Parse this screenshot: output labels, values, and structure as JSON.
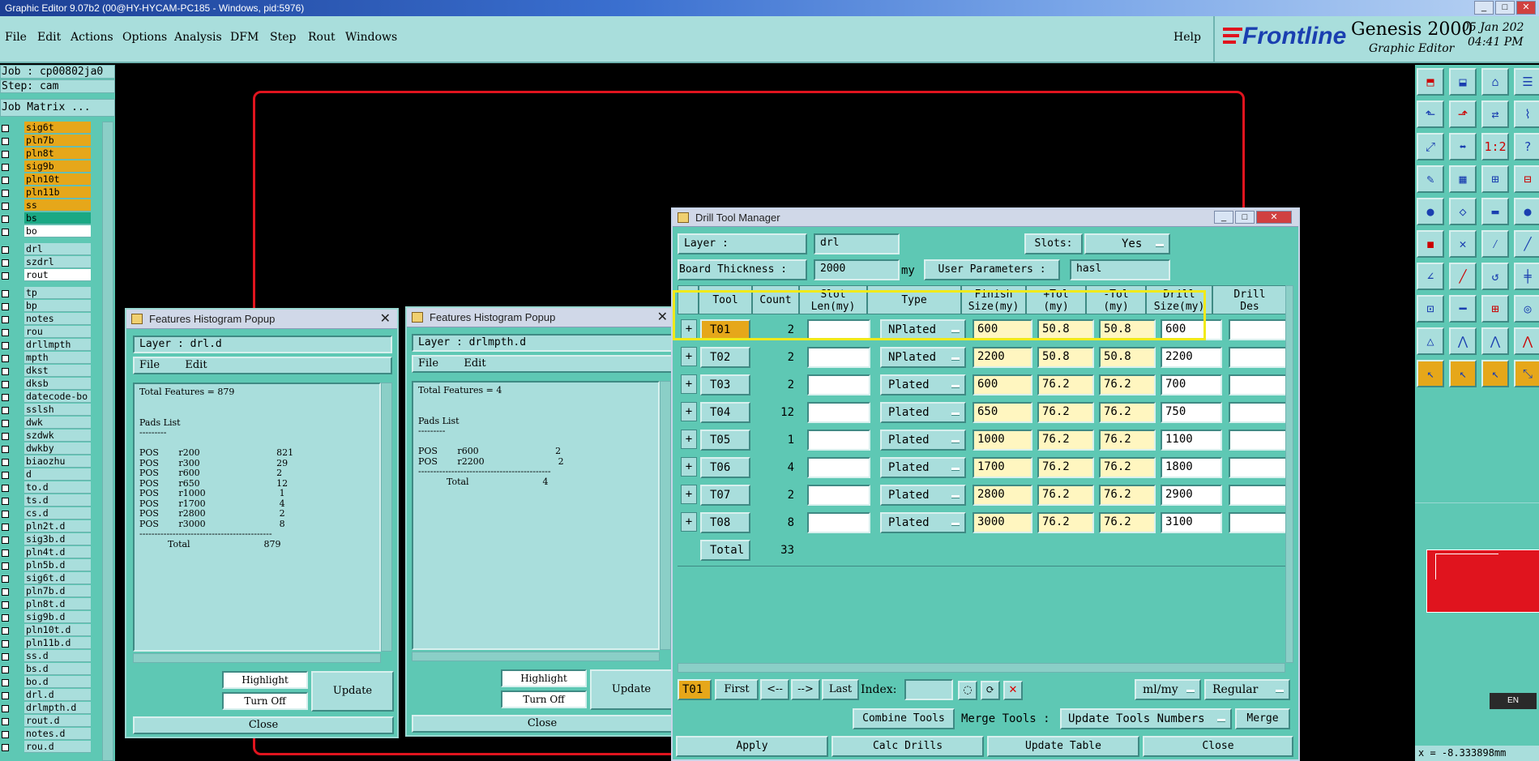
{
  "window": {
    "title": "Graphic Editor 9.07b2 (00@HY-HYCAM-PC185 - Windows, pid:5976)"
  },
  "menu": {
    "items": [
      "File",
      "Edit",
      "Actions",
      "Options",
      "Analysis",
      "DFM",
      "Step",
      "Rout",
      "Windows"
    ],
    "help": "Help"
  },
  "brand": {
    "logo": "Frontline",
    "product": "Genesis 2000",
    "subtitle": "Graphic Editor",
    "date": "05 Jan 202",
    "time": "04:41 PM"
  },
  "left_panel": {
    "job": "Job : cp00802ja0",
    "step": "Step: cam",
    "job_matrix": "Job Matrix ...",
    "layers_top": [
      {
        "name": "sig6t",
        "color": "#e6a71a"
      },
      {
        "name": "pln7b",
        "color": "#e6a71a"
      },
      {
        "name": "pln8t",
        "color": "#e6a71a"
      },
      {
        "name": "sig9b",
        "color": "#e6a71a"
      },
      {
        "name": "pln10t",
        "color": "#e6a71a"
      },
      {
        "name": "pln11b",
        "color": "#e6a71a"
      },
      {
        "name": "ss",
        "color": "#e6a71a"
      },
      {
        "name": "bs",
        "color": "#1aa884"
      },
      {
        "name": "bo",
        "color": "#ffffff"
      }
    ],
    "layers_drill": [
      {
        "name": "drl",
        "color": "#a9dedc"
      },
      {
        "name": "szdrl",
        "color": "#a9dedc"
      },
      {
        "name": "rout",
        "color": "#ffffff"
      }
    ],
    "layers_misc": [
      "tp",
      "bp",
      "notes",
      "rou",
      "drllmpth",
      "mpth",
      "dkst",
      "dksb",
      "datecode-bo",
      "sslsh",
      "dwk",
      "szdwk",
      "dwkby",
      "biaozhu",
      "d",
      "to.d",
      "ts.d",
      "cs.d",
      "pln2t.d",
      "sig3b.d",
      "pln4t.d",
      "pln5b.d",
      "sig6t.d",
      "pln7b.d",
      "pln8t.d",
      "sig9b.d",
      "pln10t.d",
      "pln11b.d",
      "ss.d",
      "bs.d",
      "bo.d",
      "drl.d",
      "drlmpth.d",
      "rout.d",
      "notes.d",
      "rou.d"
    ]
  },
  "histogram1": {
    "title": "Features Histogram Popup",
    "layer": "Layer :  drl.d",
    "menu": [
      "File",
      "Edit"
    ],
    "content": "Total Features = 879\n\n\nPads List\n---------\n\nPOS       r200                           821\nPOS       r300                           29\nPOS       r600                           2\nPOS       r650                           12\nPOS       r1000                          1\nPOS       r1700                          4\nPOS       r2800                          2\nPOS       r3000                          8\n--------------------------------------------\n          Total                          879",
    "highlight": "Highlight",
    "turn_off": "Turn Off",
    "update": "Update",
    "close": "Close"
  },
  "histogram2": {
    "title": "Features Histogram Popup",
    "layer": "Layer :  drlmpth.d",
    "menu": [
      "File",
      "Edit"
    ],
    "content": "Total Features = 4\n\n\nPads List\n---------\n\nPOS       r600                           2\nPOS       r2200                          2\n--------------------------------------------\n          Total                          4",
    "highlight": "Highlight",
    "turn_off": "Turn Off",
    "update": "Update",
    "close": "Close"
  },
  "dtm": {
    "title": "Drill Tool Manager",
    "layer_label": "Layer        :",
    "layer_value": "drl",
    "slots_label": "Slots:",
    "slots_value": "Yes",
    "board_thickness_label": "Board Thickness :",
    "board_thickness_value": "2000",
    "board_thickness_unit": "my",
    "user_params_label": "User Parameters :",
    "user_params_value": "hasl",
    "headers": [
      "Tool",
      "Count",
      "Slot\nLen(my)",
      "Type",
      "Finish\nSize(my)",
      "+Tol\n(my)",
      "-Tol\n(my)",
      "Drill\nSize(my)",
      "Drill\nDes"
    ],
    "rows": [
      {
        "tool": "T01",
        "count": "2",
        "type": "NPlated",
        "finish": "600",
        "ptol": "50.8",
        "ntol": "50.8",
        "drill": "600"
      },
      {
        "tool": "T02",
        "count": "2",
        "type": "NPlated",
        "finish": "2200",
        "ptol": "50.8",
        "ntol": "50.8",
        "drill": "2200"
      },
      {
        "tool": "T03",
        "count": "2",
        "type": "Plated",
        "finish": "600",
        "ptol": "76.2",
        "ntol": "76.2",
        "drill": "700"
      },
      {
        "tool": "T04",
        "count": "12",
        "type": "Plated",
        "finish": "650",
        "ptol": "76.2",
        "ntol": "76.2",
        "drill": "750"
      },
      {
        "tool": "T05",
        "count": "1",
        "type": "Plated",
        "finish": "1000",
        "ptol": "76.2",
        "ntol": "76.2",
        "drill": "1100"
      },
      {
        "tool": "T06",
        "count": "4",
        "type": "Plated",
        "finish": "1700",
        "ptol": "76.2",
        "ntol": "76.2",
        "drill": "1800"
      },
      {
        "tool": "T07",
        "count": "2",
        "type": "Plated",
        "finish": "2800",
        "ptol": "76.2",
        "ntol": "76.2",
        "drill": "2900"
      },
      {
        "tool": "T08",
        "count": "8",
        "type": "Plated",
        "finish": "3000",
        "ptol": "76.2",
        "ntol": "76.2",
        "drill": "3100"
      }
    ],
    "total_label": "Total",
    "total_value": "33",
    "nav": {
      "current": "T01",
      "first": "First",
      "prev": "<--",
      "next": "-->",
      "last": "Last",
      "index": "Index:",
      "units": "ml/my",
      "mode": "Regular"
    },
    "combine": "Combine Tools",
    "merge_label": "Merge Tools :",
    "merge_option": "Update Tools Numbers",
    "merge": "Merge",
    "apply": "Apply",
    "calc": "Calc Drills",
    "update_table": "Update Table",
    "close": "Close"
  },
  "status": {
    "coord": "x = -8.333898mm",
    "lang": "EN"
  },
  "colors": {
    "panel": "#5ec8b4",
    "light": "#a9dedc",
    "accent": "#e6a71a",
    "outline_red": "#e0141e",
    "highlight_yellow": "#f0ea1a"
  }
}
